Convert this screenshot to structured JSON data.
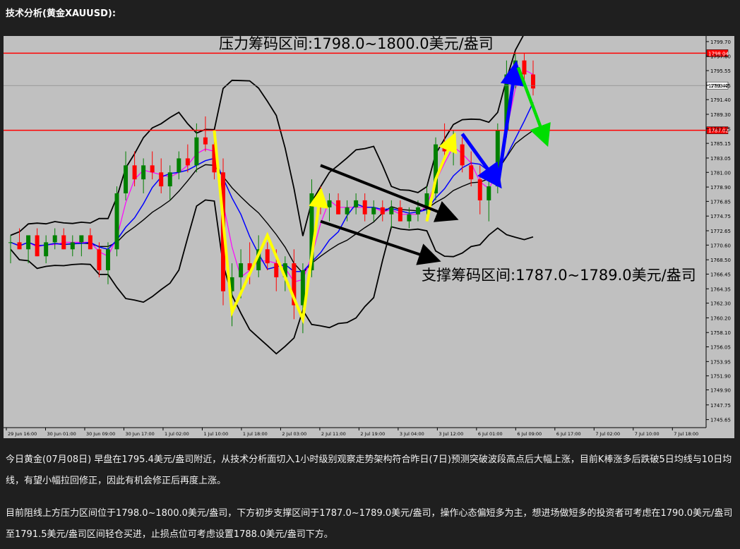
{
  "heading": "技术分析(黄金XAUUSD):",
  "paragraphs": [
    "今日黄金(07月08日) 早盘在1795.4美元/盎司附近，从技术分析面切入1小时级别观察走势架构符合昨日(7日)预测突破波段高点后大幅上涨，目前K棒涨多后跌破5日均线与10日均线，有望小幅拉回修正，因此有机会修正后再度上涨。",
    "目前阻线上方压力区间位于1798.0~1800.0美元/盎司，下方初步支撑区间于1787.0~1789.0美元/盎司，操作心态偏短多为主，想进场做短多的投资者可考虑在1790.0美元/盎司至1791.5美元/盎司区间轻仓买进，止损点位可考虑设置1788.0美元/盎司下方。"
  ],
  "colors": {
    "background": "#1f1f1f",
    "chart_bg": "#c0c0c0",
    "bull": "#008000",
    "bear": "#ff0000",
    "level_line": "#ff0000",
    "bollinger": "#000000",
    "ma_fast": "#ff00ff",
    "ma_slow": "#0000ff",
    "arrow_yellow": "#ffff00",
    "arrow_blue": "#0000ff",
    "arrow_green": "#00dd00",
    "arrow_black": "#000000"
  },
  "chart_data": {
    "type": "candlestick",
    "symbol": "XAUUSD",
    "timeframe": "H1",
    "ylim": [
      1744.5,
      1800.5
    ],
    "y_ticks": [
      "1745.65",
      "1747.75",
      "1749.90",
      "1751.90",
      "1753.95",
      "1756.05",
      "1758.10",
      "1760.20",
      "1762.30",
      "1764.35",
      "1766.45",
      "1768.50",
      "1770.60",
      "1772.65",
      "1774.75",
      "1776.85",
      "1778.90",
      "1781.00",
      "1783.05",
      "1785.15",
      "1787.25",
      "1789.30",
      "1791.40",
      "1793.45",
      "1795.55",
      "1797.60",
      "1799.70"
    ],
    "x_ticks": [
      "29 Jun 16:00",
      "30 Jun 01:00",
      "30 Jun 09:00",
      "30 Jun 17:00",
      "1 Jul 02:00",
      "1 Jul 10:00",
      "1 Jul 18:00",
      "2 Jul 03:00",
      "2 Jul 11:00",
      "2 Jul 19:00",
      "3 Jul 04:00",
      "3 Jul 12:00",
      "6 Jul 01:00",
      "6 Jul 09:00",
      "6 Jul 17:00",
      "7 Jul 02:00",
      "7 Jul 10:00",
      "7 Jul 18:00",
      "8 Jul 03:00"
    ],
    "price_labels": [
      {
        "value": 1798.04,
        "text": "1798.04",
        "color": "#ff0000"
      },
      {
        "value": 1793.42,
        "text": "1793.42",
        "color": "#000000"
      },
      {
        "value": 1787.02,
        "text": "1787.02",
        "color": "#ff0000"
      }
    ],
    "resistance_level": 1798.04,
    "support_level": 1787.02,
    "current_price": 1793.42,
    "annotations": [
      {
        "text": "压力筹码区间:1798.0~1800.0美元/盎司",
        "role": "resistance"
      },
      {
        "text": "支撑筹码区间:1787.0~1789.0美元/盎司",
        "role": "support"
      }
    ],
    "candles_approx": [
      [
        1771,
        1772,
        1768,
        1771
      ],
      [
        1771,
        1773,
        1770,
        1770
      ],
      [
        1770,
        1772,
        1768,
        1772
      ],
      [
        1772,
        1773,
        1769,
        1769
      ],
      [
        1769,
        1772,
        1768,
        1771
      ],
      [
        1771,
        1773,
        1770,
        1772
      ],
      [
        1772,
        1773,
        1770,
        1770
      ],
      [
        1770,
        1772,
        1769,
        1771
      ],
      [
        1771,
        1772,
        1769,
        1772
      ],
      [
        1772,
        1773,
        1770,
        1770
      ],
      [
        1770,
        1771,
        1766,
        1767
      ],
      [
        1767,
        1771,
        1765,
        1770
      ],
      [
        1770,
        1779,
        1769,
        1778
      ],
      [
        1778,
        1784,
        1777,
        1782
      ],
      [
        1782,
        1784,
        1779,
        1780
      ],
      [
        1780,
        1783,
        1778,
        1782
      ],
      [
        1782,
        1784,
        1780,
        1781
      ],
      [
        1781,
        1783,
        1778,
        1779
      ],
      [
        1779,
        1782,
        1777,
        1781
      ],
      [
        1781,
        1784,
        1780,
        1783
      ],
      [
        1783,
        1785,
        1781,
        1782
      ],
      [
        1782,
        1788,
        1781,
        1786
      ],
      [
        1786,
        1789,
        1784,
        1785
      ],
      [
        1785,
        1787,
        1780,
        1781
      ],
      [
        1781,
        1783,
        1762,
        1764
      ],
      [
        1764,
        1768,
        1759,
        1766
      ],
      [
        1766,
        1770,
        1763,
        1768
      ],
      [
        1768,
        1771,
        1765,
        1767
      ],
      [
        1767,
        1772,
        1766,
        1770
      ],
      [
        1770,
        1771,
        1767,
        1768
      ],
      [
        1768,
        1770,
        1764,
        1766
      ],
      [
        1766,
        1769,
        1764,
        1768
      ],
      [
        1768,
        1770,
        1760,
        1762
      ],
      [
        1762,
        1768,
        1758,
        1767
      ],
      [
        1767,
        1780,
        1766,
        1778
      ],
      [
        1778,
        1779,
        1775,
        1776
      ],
      [
        1776,
        1778,
        1774,
        1777
      ],
      [
        1777,
        1778,
        1775,
        1775
      ],
      [
        1775,
        1777,
        1774,
        1776
      ],
      [
        1776,
        1778,
        1775,
        1777
      ],
      [
        1777,
        1778,
        1774,
        1775
      ],
      [
        1775,
        1777,
        1774,
        1776
      ],
      [
        1776,
        1777,
        1774,
        1775
      ],
      [
        1775,
        1777,
        1773,
        1776
      ],
      [
        1776,
        1777,
        1774,
        1774
      ],
      [
        1774,
        1776,
        1773,
        1775
      ],
      [
        1775,
        1777,
        1774,
        1776
      ],
      [
        1776,
        1779,
        1775,
        1778
      ],
      [
        1778,
        1786,
        1777,
        1785
      ],
      [
        1785,
        1788,
        1783,
        1784
      ],
      [
        1784,
        1787,
        1782,
        1785
      ],
      [
        1785,
        1786,
        1781,
        1782
      ],
      [
        1782,
        1784,
        1779,
        1780
      ],
      [
        1780,
        1782,
        1775,
        1777
      ],
      [
        1777,
        1780,
        1774,
        1779
      ],
      [
        1779,
        1788,
        1778,
        1787
      ],
      [
        1787,
        1797,
        1786,
        1795
      ],
      [
        1795,
        1798,
        1793,
        1797
      ],
      [
        1797,
        1798,
        1794,
        1795
      ],
      [
        1795,
        1797,
        1792,
        1793
      ]
    ]
  }
}
